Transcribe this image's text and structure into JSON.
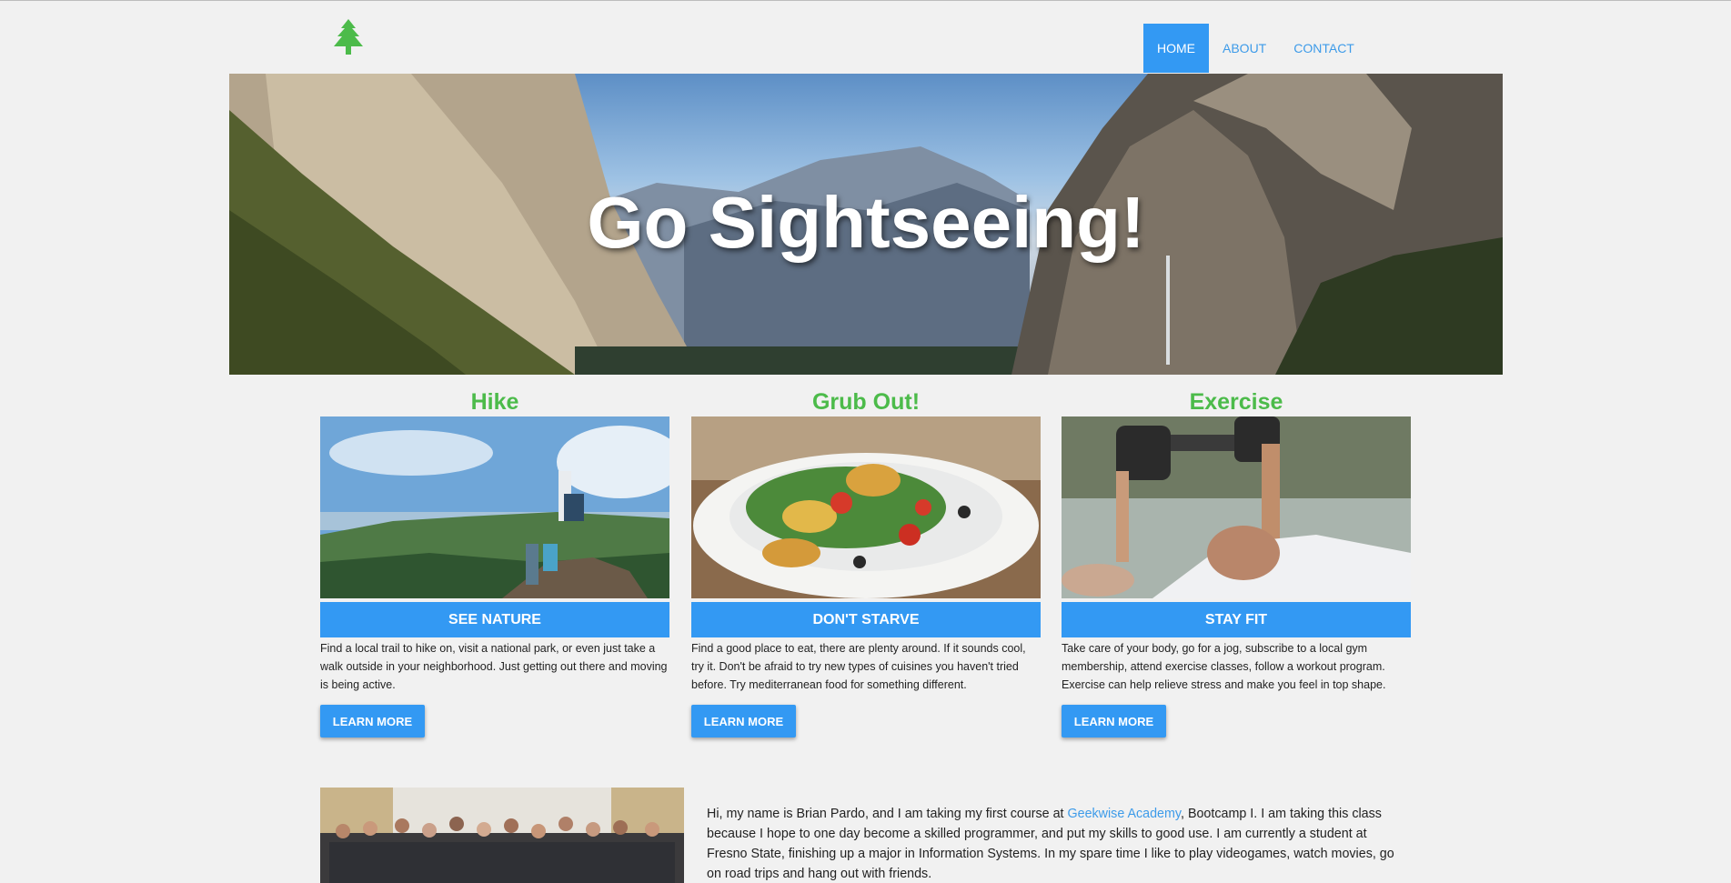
{
  "header": {
    "logo_icon": "pine-tree-icon",
    "nav": [
      {
        "label": "HOME",
        "active": true
      },
      {
        "label": "ABOUT",
        "active": false
      },
      {
        "label": "CONTACT",
        "active": false
      }
    ]
  },
  "hero": {
    "title": "Go Sightseeing!"
  },
  "cards": [
    {
      "title": "Hike",
      "band": "SEE NATURE",
      "text": "Find a local trail to hike on, visit a national park, or even just take a walk outside in your neighborhood. Just getting out there and moving is being active.",
      "button": "LEARN MORE"
    },
    {
      "title": "Grub Out!",
      "band": "DON'T STARVE",
      "text": "Find a good place to eat, there are plenty around. If it sounds cool, try it. Don't be afraid to try new types of cuisines you haven't tried before. Try mediterranean food for something different.",
      "button": "LEARN MORE"
    },
    {
      "title": "Exercise",
      "band": "STAY FIT",
      "text": "Take care of your body, go for a jog, subscribe to a local gym membership, attend exercise classes, follow a workout program. Exercise can help relieve stress and make you feel in top shape.",
      "button": "LEARN MORE"
    }
  ],
  "about": {
    "intro": "Hi, my name is Brian Pardo, and I am taking my first course at ",
    "link": "Geekwise Academy",
    "rest": ", Bootcamp I. I am taking this class because I hope to one day become a skilled programmer, and put my skills to good use. I am currently a student at Fresno State, finishing up a major in Information Systems. In my spare time I like to play videogames, watch movies, go on road trips and hang out with friends."
  },
  "colors": {
    "accent": "#3399f3",
    "heading_green": "#4cbb4a",
    "background": "#f1f1f1"
  }
}
